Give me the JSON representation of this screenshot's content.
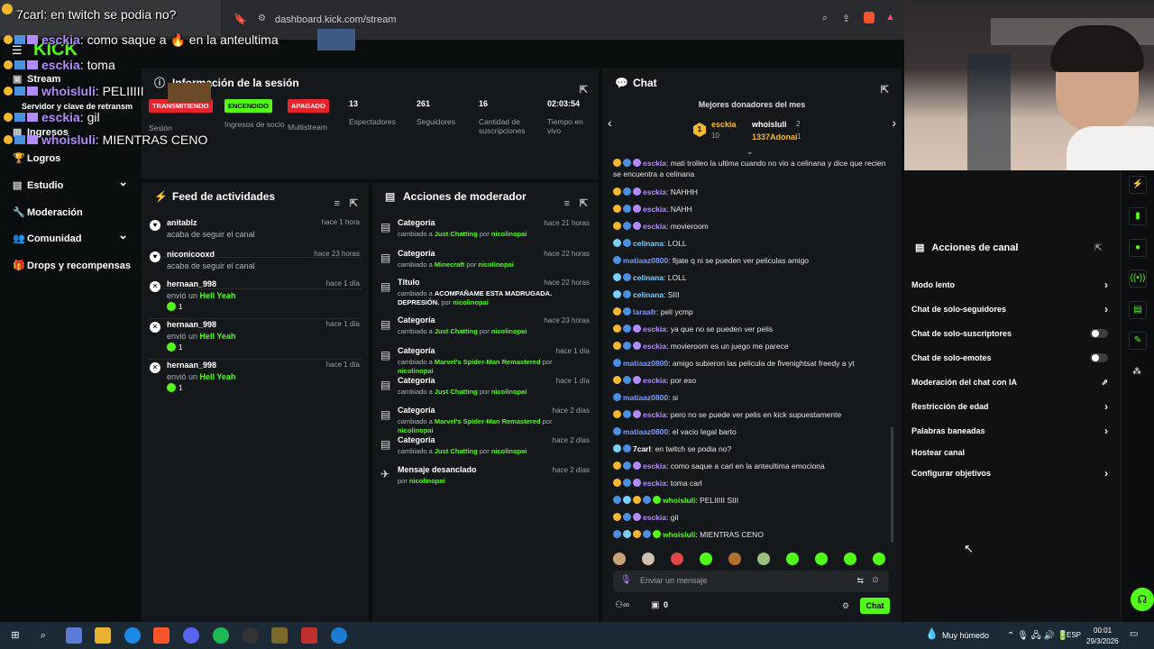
{
  "browser": {
    "tab_title": "7carl: en twitch se podia no?",
    "url": "dashboard.kick.com/stream"
  },
  "stream_overlay": {
    "logo_text": "KICK",
    "lines": [
      {
        "user": "esckia",
        "text": ": como saque a",
        "extra": "en la anteultima"
      },
      {
        "user": "esckia",
        "text": ": toma"
      },
      {
        "user": "whoisluli",
        "text": ": PELIIIII"
      },
      {
        "user": "esckia",
        "text": ": gil"
      },
      {
        "user": "whoisluli",
        "text": ": MIENTRAS CENO"
      }
    ]
  },
  "sidebar": {
    "items": [
      {
        "label": "Stream",
        "icon": "stream-icon"
      },
      {
        "label": "Servidor y clave de retransm",
        "icon": "key-icon"
      },
      {
        "label": "Ingresos",
        "icon": "money-icon"
      },
      {
        "label": "Logros",
        "icon": "trophy-icon"
      },
      {
        "label": "Estudio",
        "icon": "studio-icon",
        "chevron": "⌄"
      },
      {
        "label": "Moderación",
        "icon": "wrench-icon"
      },
      {
        "label": "Comunidad",
        "icon": "community-icon",
        "chevron": "⌄"
      },
      {
        "label": "Drops y recompensas",
        "icon": "gift-icon"
      }
    ]
  },
  "session": {
    "title": "Información de la sesión",
    "cells": [
      {
        "pill": "TRANSMITIENDO",
        "label": "Sesión",
        "pill_color": "#e5242b"
      },
      {
        "pill": "ENCENDIDO",
        "label": "Ingresos de socio",
        "pill_color": "#53fc18"
      },
      {
        "pill": "APAGADO",
        "label": "Multistream",
        "pill_color": "#e5242b"
      },
      {
        "num": "13",
        "label": "Espectadores"
      },
      {
        "num": "261",
        "label": "Seguidores"
      },
      {
        "num": "16",
        "label": "Cantidad de suscripciones"
      },
      {
        "num": "02:03:54",
        "label": "Tiempo en vivo"
      }
    ]
  },
  "feed": {
    "title": "Feed de actividades",
    "items": [
      {
        "name": "anitablz",
        "desc": "acaba de seguir el canal",
        "time": "hace 1 hora",
        "icon": "heart-icon"
      },
      {
        "name": "niconicooxd",
        "desc": "acaba de seguir el canal",
        "time": "hace 23 horas",
        "icon": "heart-icon"
      },
      {
        "name": "hernaan_998",
        "desc": "envió un",
        "gift": "Hell Yeah",
        "count": "1",
        "time": "hace 1 día",
        "icon": "kick-gift-icon"
      },
      {
        "name": "hernaan_998",
        "desc": "envió un",
        "gift": "Hell Yeah",
        "count": "1",
        "time": "hace 1 día",
        "icon": "kick-gift-icon"
      },
      {
        "name": "hernaan_998",
        "desc": "envió un",
        "gift": "Hell Yeah",
        "count": "1",
        "time": "hace 1 día",
        "icon": "kick-gift-icon"
      }
    ]
  },
  "mod": {
    "title": "Acciones de moderador",
    "items": [
      {
        "name": "Categoría",
        "pre": "cambiado a",
        "value": "Just Chatting",
        "by": "por",
        "user": "nicolinopai",
        "time": "hace 21 horas"
      },
      {
        "name": "Categoría",
        "pre": "cambiado a",
        "value": "Minecraft",
        "by": "por",
        "user": "nicolinopai",
        "time": "hace 22 horas"
      },
      {
        "name": "Título",
        "pre": "cambiado a",
        "value": "ACOMPAÑAME ESTA MADRUGADA. DEPRESIÓN.",
        "by": "por",
        "user": "nicolinopai",
        "time": "hace 22 horas",
        "white": true
      },
      {
        "name": "Categoría",
        "pre": "cambiado a",
        "value": "Just Chatting",
        "by": "por",
        "user": "nicolinopai",
        "time": "hace 23 horas"
      },
      {
        "name": "Categoría",
        "pre": "cambiado a",
        "value": "Marvel's Spider-Man Remastered",
        "by": "por",
        "user": "nicolinopai",
        "time": "hace 1 día"
      },
      {
        "name": "Categoría",
        "pre": "cambiado a",
        "value": "Just Chatting",
        "by": "por",
        "user": "nicolinopai",
        "time": "hace 1 día"
      },
      {
        "name": "Categoría",
        "pre": "cambiado a",
        "value": "Marvel's Spider-Man Remastered",
        "by": "por",
        "user": "nicolinopai",
        "time": "hace 2 días"
      },
      {
        "name": "Categoría",
        "pre": "cambiado a",
        "value": "Just Chatting",
        "by": "por",
        "user": "nicolinopai",
        "time": "hace 2 días"
      },
      {
        "name": "Mensaje desanclado",
        "pre": "",
        "value": "",
        "by": "por",
        "user": "nicolinopai",
        "time": "hace 2 días"
      }
    ]
  },
  "chat": {
    "title": "Chat",
    "donors_title": "Mejores donadores del mes",
    "donors": [
      {
        "name": "esckia",
        "count": "10"
      },
      {
        "name": "whoisluli",
        "count": "2"
      },
      {
        "name": "1337Adonai",
        "count": "1"
      }
    ],
    "messages": [
      {
        "user": "esckia",
        "color": "#b48aff",
        "text": ": mati trolleo la ultima cuando no vio a celinana y dice que recien se encuentra a celinana",
        "badges": "o"
      },
      {
        "user": "esckia",
        "color": "#b48aff",
        "text": ": NAHHH",
        "badges": "o"
      },
      {
        "user": "esckia",
        "color": "#b48aff",
        "text": ": NAHH",
        "badges": "o"
      },
      {
        "user": "esckia",
        "color": "#b48aff",
        "text": ": movieroom",
        "badges": "o"
      },
      {
        "user": "celinana",
        "color": "#7ad0ff",
        "text": ": LOLL",
        "badges": "b"
      },
      {
        "user": "matiaaz0800",
        "color": "#7a9bff",
        "text": ": fijate q ni se pueden ver peliculas amigo",
        "badges": "x"
      },
      {
        "user": "celinana",
        "color": "#7ad0ff",
        "text": ": LOLL",
        "badges": "b"
      },
      {
        "user": "celinana",
        "color": "#7ad0ff",
        "text": ": SIII",
        "badges": "b"
      },
      {
        "user": "laraafr",
        "color": "#7a9bff",
        "text": ": peli ycmp",
        "badges": "c"
      },
      {
        "user": "esckia",
        "color": "#b48aff",
        "text": ": ya que no se pueden ver pelis",
        "badges": "o"
      },
      {
        "user": "esckia",
        "color": "#b48aff",
        "text": ": movieroom es un juego me parece",
        "badges": "o"
      },
      {
        "user": "matiaaz0800",
        "color": "#7a9bff",
        "text": ": amigo subieron las pelicula de fivenightsat freedy a yt",
        "badges": "x"
      },
      {
        "user": "esckia",
        "color": "#b48aff",
        "text": ": por eso",
        "badges": "o"
      },
      {
        "user": "matiaaz0800",
        "color": "#7a9bff",
        "text": ": si",
        "badges": "x"
      },
      {
        "user": "esckia",
        "color": "#b48aff",
        "text": ": pero no se puede ver pelis en kick supuestamente",
        "badges": "o"
      },
      {
        "user": "matiaaz0800",
        "color": "#7a9bff",
        "text": ": el vacio legal barto",
        "badges": "x"
      },
      {
        "user": "7carl",
        "color": "#ffffff",
        "text": ": en twitch se podia no?",
        "badges": "b"
      },
      {
        "user": "esckia",
        "color": "#b48aff",
        "text": ": como saque a carl en la anteultima emociona",
        "badges": "o"
      },
      {
        "user": "esckia",
        "color": "#b48aff",
        "text": ": toma carl",
        "badges": "o"
      },
      {
        "user": "whoisluli",
        "color": "#53fc18",
        "text": ": PELIIIII SIII",
        "badges": "m"
      },
      {
        "user": "esckia",
        "color": "#b48aff",
        "text": ": gil",
        "badges": "o"
      },
      {
        "user": "whoisluli",
        "color": "#53fc18",
        "text": ": MIENTRAS CENO",
        "badges": "m"
      }
    ],
    "input_placeholder": "Enviar un mensaje",
    "send_label": "Chat",
    "points": "0"
  },
  "channel_actions": {
    "title": "Acciones de canal",
    "items": [
      {
        "label": "Modo lento",
        "kind": "arrow"
      },
      {
        "label": "Chat de solo-seguidores",
        "kind": "arrow"
      },
      {
        "label": "Chat de solo-suscriptores",
        "kind": "toggle"
      },
      {
        "label": "Chat de solo-emotes",
        "kind": "toggle"
      },
      {
        "label": "Moderación del chat con IA",
        "kind": "external"
      },
      {
        "label": "Restricción de edad",
        "kind": "arrow"
      },
      {
        "label": "Palabras baneadas",
        "kind": "arrow"
      },
      {
        "label": "Hostear canal",
        "kind": "none"
      },
      {
        "label": "Configurar objetivos",
        "kind": "arrow"
      }
    ]
  },
  "taskbar": {
    "weather": "Muy húmedo",
    "lang": "ESP",
    "time": "00:01",
    "date": "29/3/2026"
  },
  "colors": {
    "accent": "#53fc18",
    "live": "#e5242b",
    "panel": "#15181a"
  }
}
